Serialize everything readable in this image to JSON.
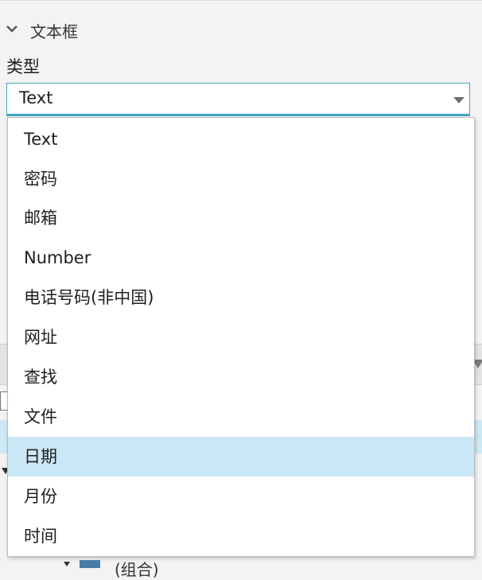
{
  "section": {
    "title": "文本框",
    "icon": "chevron-down-icon"
  },
  "type_field": {
    "label": "类型",
    "selected": "Text"
  },
  "dropdown": {
    "options": [
      "Text",
      "密码",
      "邮箱",
      "Number",
      "电话号码(非中国)",
      "网址",
      "查找",
      "文件",
      "日期",
      "月份",
      "时间"
    ],
    "highlighted": "日期"
  },
  "background": {
    "group_label": "(组合)"
  },
  "colors": {
    "accent": "#3fa7c2",
    "highlight": "#cbe8f6",
    "panel": "#f3f3f3"
  }
}
